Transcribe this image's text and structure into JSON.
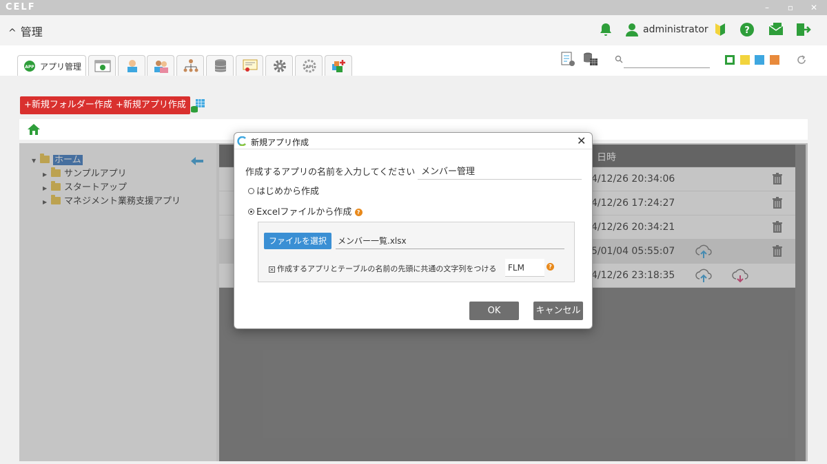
{
  "window": {
    "logo": "CELF",
    "controls": [
      "–",
      "▫",
      "✕"
    ]
  },
  "header": {
    "section_title": "管理",
    "username": "administrator",
    "icons": [
      "bell-icon",
      "user-icon",
      "beginner-mark-icon",
      "help-icon",
      "message-icon",
      "logout-icon"
    ]
  },
  "toolbar": {
    "active_tab_label": "アプリ管理",
    "tabs": [
      "app-management",
      "app-screen",
      "user",
      "group",
      "organization",
      "database",
      "certificate",
      "settings",
      "api",
      "plugin"
    ],
    "search_placeholder": "",
    "color_swatches": [
      "#2e9e3a",
      "#f2d43d",
      "#3ea7e0",
      "#e88a3c"
    ]
  },
  "actions": {
    "new_folder": "+新規フォルダー作成",
    "new_app": "+新規アプリ作成"
  },
  "tree": {
    "root": "ホーム",
    "children": [
      "サンプルアプリ",
      "スタートアップ",
      "マネジメント業務支援アプリ"
    ]
  },
  "grid": {
    "header_text": "日時",
    "rows": [
      {
        "date": "4/12/26 20:34:06",
        "upload": false,
        "download": false,
        "delete": true
      },
      {
        "date": "4/12/26 17:24:27",
        "upload": false,
        "download": false,
        "delete": true
      },
      {
        "date": "4/12/26 20:34:21",
        "upload": false,
        "download": false,
        "delete": true
      },
      {
        "date": "5/01/04 05:55:07",
        "upload": true,
        "download": false,
        "delete": true
      },
      {
        "date": "4/12/26 23:18:35",
        "upload": true,
        "download": true,
        "delete": false
      }
    ]
  },
  "dialog": {
    "title": "新規アプリ作成",
    "name_label": "作成するアプリの名前を入力してください",
    "name_value": "メンバー管理",
    "option_scratch": "はじめから作成",
    "option_excel": "Excelファイルから作成",
    "selected_option": "excel",
    "file_button": "ファイルを選択",
    "file_name": "メンバー一覧.xlsx",
    "prefix_label": "作成するアプリとテーブルの名前の先頭に共通の文字列をつける",
    "prefix_checked": true,
    "prefix_value": "FLM",
    "ok": "OK",
    "cancel": "キャンセル"
  }
}
